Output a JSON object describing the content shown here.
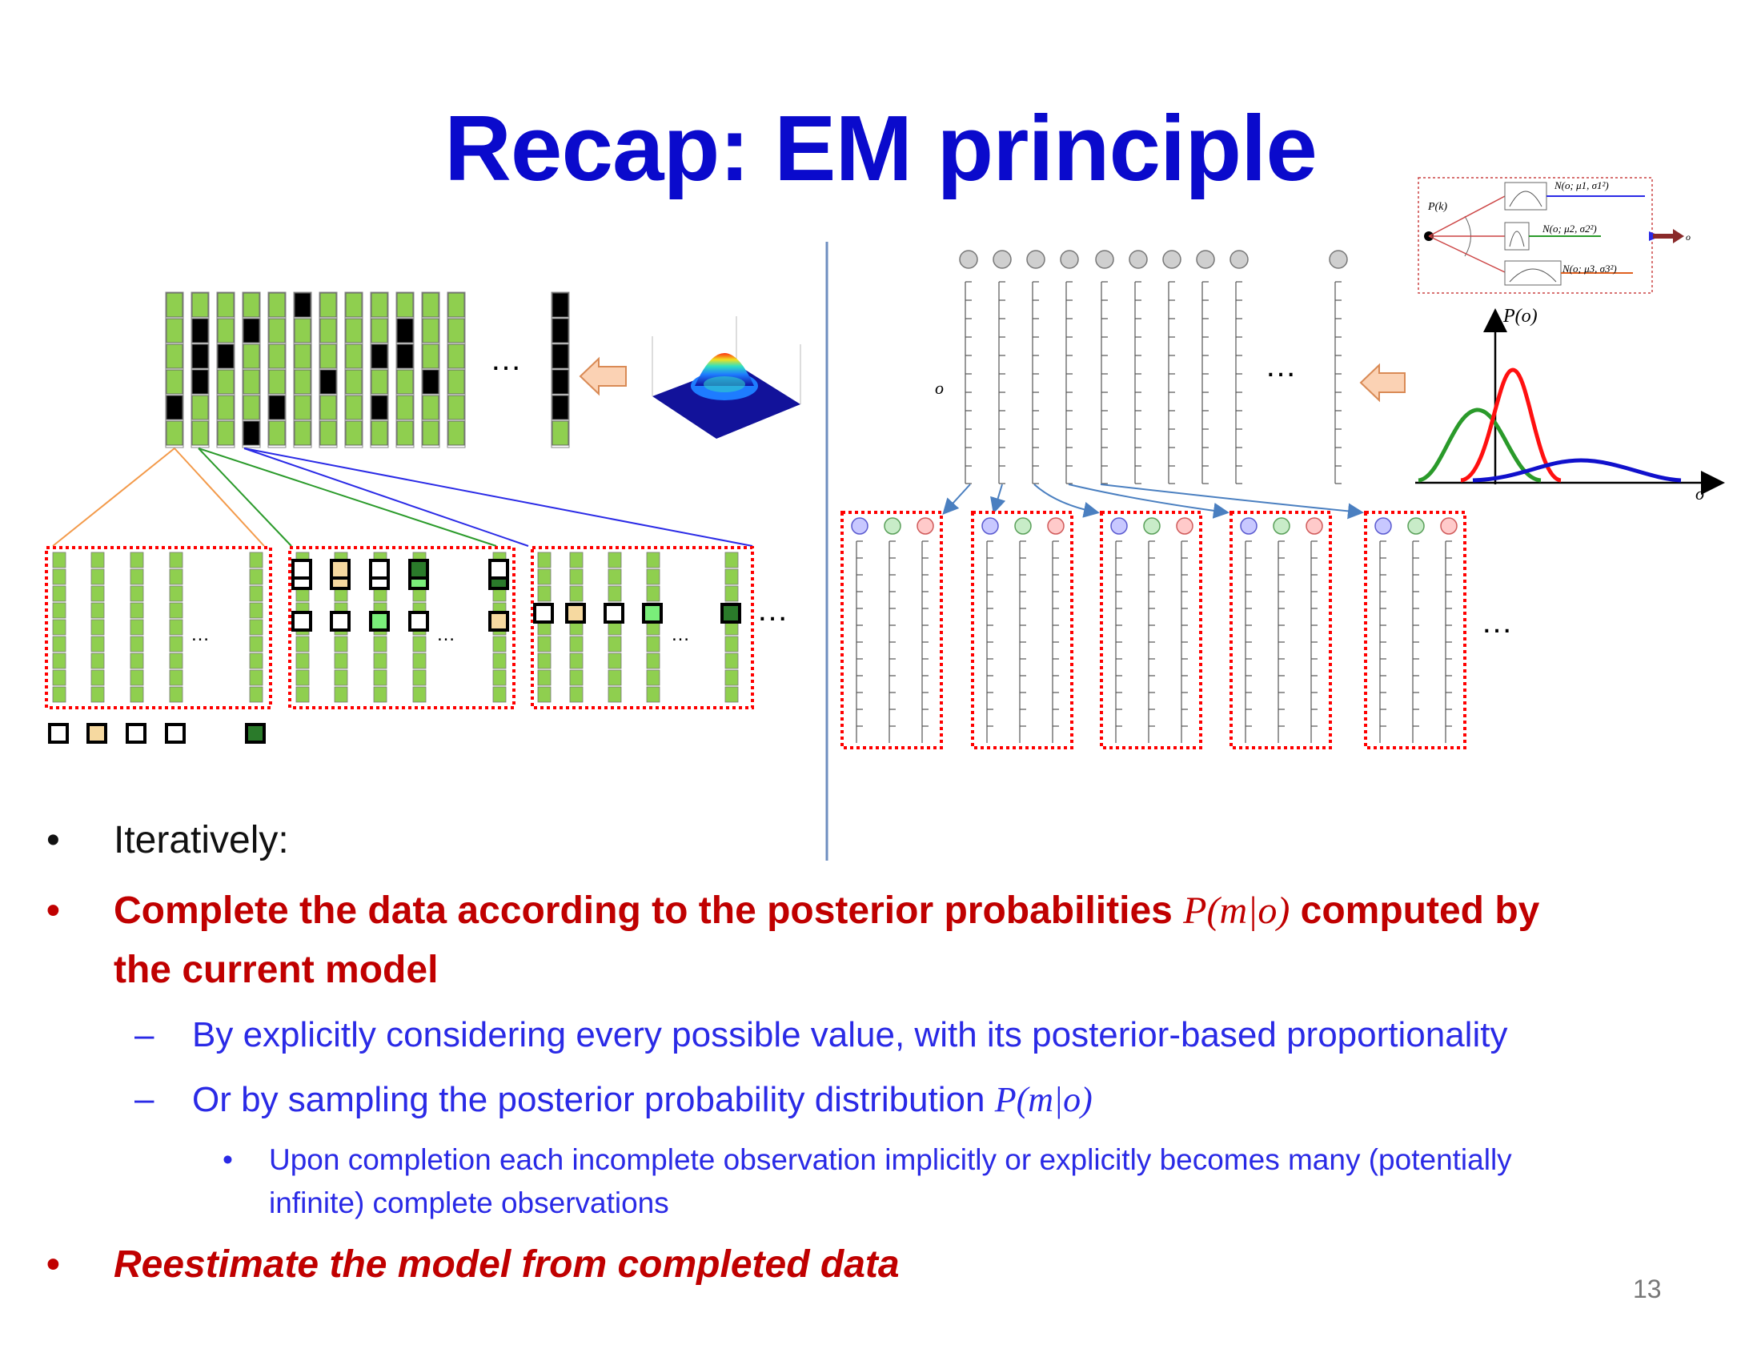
{
  "title": "Recap: EM principle",
  "figure": {
    "ellipsis": "…",
    "obs_label": "o",
    "p_of_o": "P(o)",
    "axis_o": "o",
    "mixture": {
      "pk": "P(k)",
      "n1": "N(o; μ1, σ1²)",
      "n2": "N(o; μ2, σ2²)",
      "n3": "N(o; μ3, σ3²)",
      "out": "o"
    }
  },
  "bullets": {
    "b1": "Iteratively:",
    "b2_pre": "Complete the data according to the posterior probabilities ",
    "b2_math": "P(m|o)",
    "b2_post": " computed by",
    "b2_line2": "the current model",
    "s1": "By explicitly considering every possible value, with its posterior-based proportionality",
    "s2_pre": "Or by sampling the posterior probability distribution ",
    "s2_math": "P(m|o)",
    "ss1_line1": "Upon completion each incomplete observation implicitly or explicitly becomes many (potentially",
    "ss1_line2": "infinite) complete observations",
    "b3": "Reestimate the model from completed data",
    "bullet_char": "•",
    "dash_char": "–"
  },
  "page_number": "13",
  "colors": {
    "title": "#0a0acc",
    "red": "#c00000",
    "blue": "#2a2ae6",
    "green_cell": "#8fcf4f"
  }
}
